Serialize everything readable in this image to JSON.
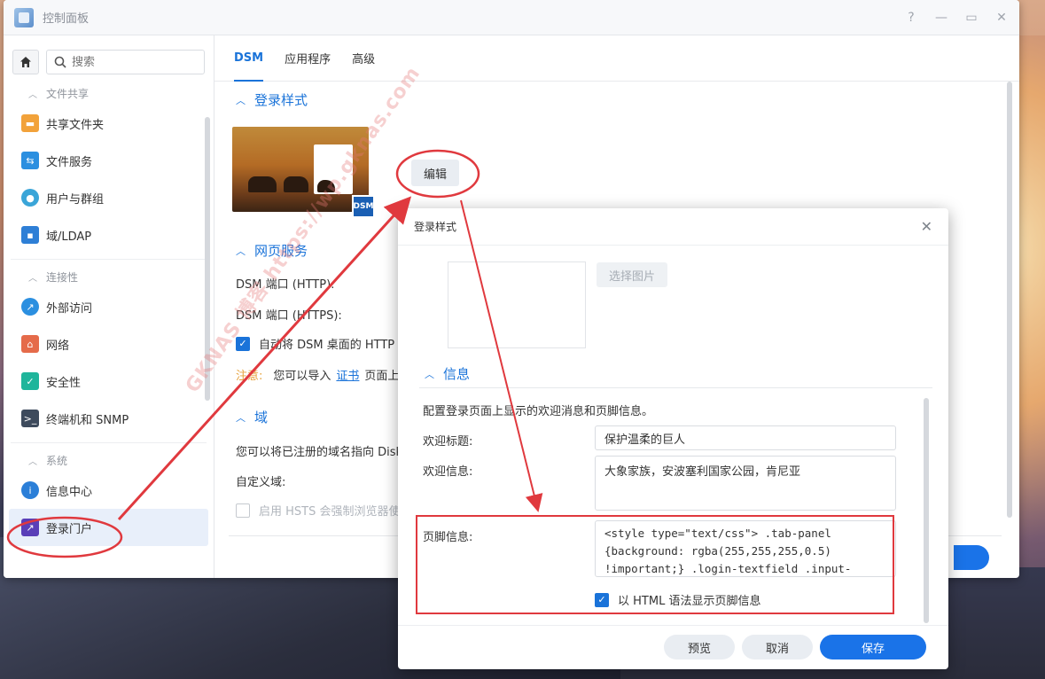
{
  "window": {
    "title": "控制面板",
    "controls": [
      "?",
      "—",
      "▭",
      "✕"
    ]
  },
  "sidebar": {
    "search_placeholder": "搜索",
    "sections": {
      "file_sharing": "文件共享",
      "connectivity": "连接性",
      "system": "系统"
    },
    "items": {
      "shared_folder": "共享文件夹",
      "file_services": "文件服务",
      "user_group": "用户与群组",
      "domain_ldap": "域/LDAP",
      "external_access": "外部访问",
      "network": "网络",
      "security": "安全性",
      "terminal_snmp": "终端机和 SNMP",
      "info_center": "信息中心",
      "login_portal": "登录门户"
    }
  },
  "tabs": [
    "DSM",
    "应用程序",
    "高级"
  ],
  "main": {
    "login_style_title": "登录样式",
    "edit_button": "编辑",
    "dsm_badge": "DSM",
    "web_services_title": "网页服务",
    "dsm_port_http": "DSM 端口 (HTTP):",
    "dsm_port_https": "DSM 端口 (HTTPS):",
    "auto_redirect": "自动将 DSM 桌面的 HTTP",
    "note_prefix": "注意:",
    "note_text": "您可以导入",
    "note_link": "证书",
    "note_suffix": "页面上",
    "domain_title": "域",
    "domain_desc": "您可以将已注册的域名指向 Disk",
    "custom_domain": "自定义域:",
    "hsts_label": "启用 HSTS 会强制浏览器使"
  },
  "dialog": {
    "title": "登录样式",
    "choose_image": "选择图片",
    "info_section": "信息",
    "description": "配置登录页面上显示的欢迎消息和页脚信息。",
    "welcome_title_label": "欢迎标题:",
    "welcome_title_value": "保护温柔的巨人",
    "welcome_msg_label": "欢迎信息:",
    "welcome_msg_value": "大象家族，安波塞利国家公园，肯尼亚",
    "footer_label": "页脚信息:",
    "footer_value": "<style type=\"text/css\"> .tab-panel {background: rgba(255,255,255,0.5) !important;} .login-textfield .input-container",
    "html_checkbox_label": "以 HTML 语法显示页脚信息",
    "buttons": {
      "preview": "预览",
      "cancel": "取消",
      "save": "保存"
    }
  },
  "watermark": "GKNAS 博客 https://wp.gknas.com",
  "colors": {
    "accent": "#1a73d9",
    "annotation": "#e0393e"
  }
}
